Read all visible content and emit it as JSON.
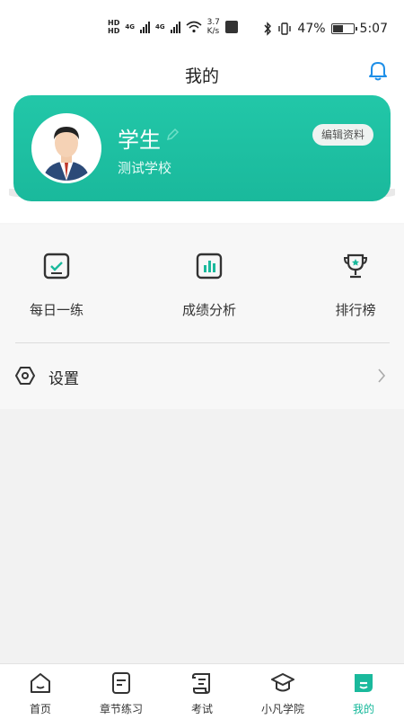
{
  "status_bar": {
    "hd1": "HD",
    "hd2": "HD",
    "net1": "4G",
    "net2": "4G",
    "speed_value": "3.7",
    "speed_unit": "K/s",
    "battery": "47%",
    "battery_level": 0.47,
    "time": "5:07"
  },
  "header": {
    "title": "我的"
  },
  "profile": {
    "name": "学生",
    "school": "测试学校",
    "edit_label": "编辑资料"
  },
  "features": [
    {
      "label": "每日一练",
      "icon": "daily-check-icon"
    },
    {
      "label": "成绩分析",
      "icon": "bar-chart-icon"
    },
    {
      "label": "排行榜",
      "icon": "trophy-icon"
    }
  ],
  "settings": {
    "label": "设置",
    "icon": "hexagon-settings-icon"
  },
  "tabs": [
    {
      "label": "首页",
      "icon": "home-icon"
    },
    {
      "label": "章节练习",
      "icon": "document-icon"
    },
    {
      "label": "考试",
      "icon": "scroll-icon"
    },
    {
      "label": "小凡学院",
      "icon": "graduation-cap-icon"
    },
    {
      "label": "我的",
      "icon": "profile-icon",
      "active": true
    }
  ],
  "colors": {
    "accent": "#1ab99c",
    "bell": "#1e8fe8"
  }
}
